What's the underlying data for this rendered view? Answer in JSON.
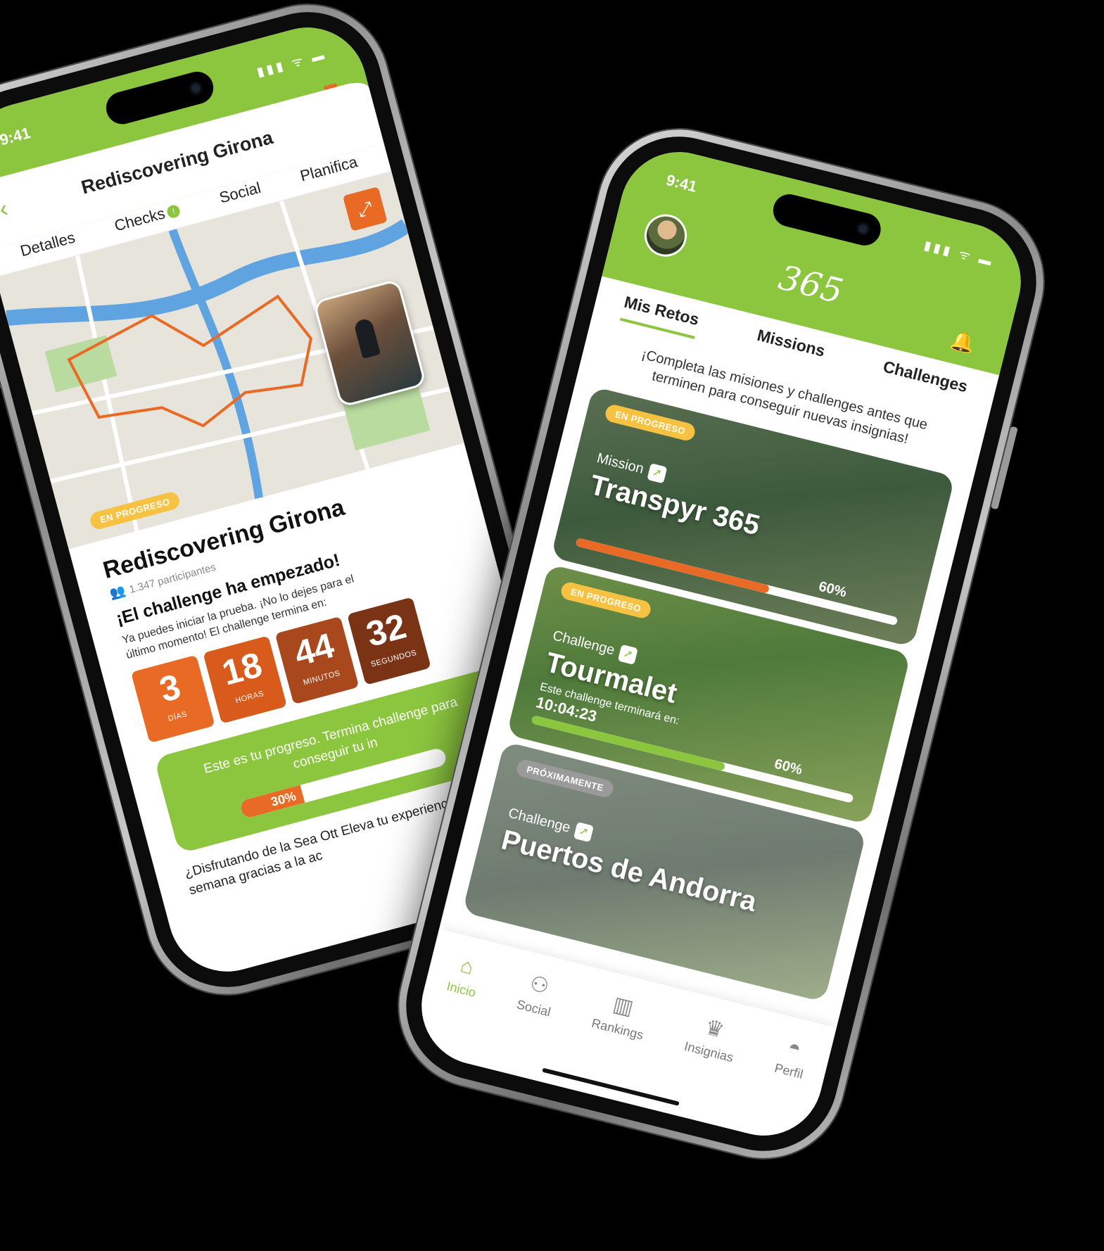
{
  "status": {
    "time": "9:41",
    "icons": "▮▮▮ ᯤ ▬"
  },
  "left": {
    "header_title": "Rediscovering Girona",
    "tabs": [
      {
        "label": "Detalles"
      },
      {
        "label": "Checks",
        "badge": "!"
      },
      {
        "label": "Social"
      },
      {
        "label": "Planifica"
      }
    ],
    "badge_status": "EN PROGRESO",
    "title": "Rediscovering Girona",
    "participants": "1.347 participantes",
    "heading": "¡El challenge ha empezado!",
    "description": "Ya puedes iniciar la prueba. ¡No lo dejes para el último momento! El challenge termina en:",
    "countdown": [
      {
        "value": "3",
        "label": "DÍAS",
        "color": "#e96a24"
      },
      {
        "value": "18",
        "label": "HORAS",
        "color": "#d85b1c"
      },
      {
        "value": "44",
        "label": "MINUTOS",
        "color": "#a9481c"
      },
      {
        "value": "32",
        "label": "SEGUNDOS",
        "color": "#7a3315"
      }
    ],
    "progress_text": "Este es tu progreso. Termina challenge para conseguir tu in",
    "progress_percent": 30,
    "progress_label": "30%",
    "footer_text": "¿Disfrutando de la Sea Ott Eleva tu experiencia cicli semana gracias a la ac"
  },
  "right": {
    "logo": "365",
    "tabs": [
      {
        "label": "Mis Retos",
        "active": true
      },
      {
        "label": "Missions"
      },
      {
        "label": "Challenges"
      }
    ],
    "intro": "¡Completa las misiones y challenges antes que terminen para conseguir nuevas insignias!",
    "cards": [
      {
        "status": "EN PROGRESO",
        "kind": "Mission",
        "name": "Transpyr 365",
        "percent": 60,
        "percent_label": "60%",
        "bar_color": "#e96a24"
      },
      {
        "status": "EN PROGRESO",
        "kind": "Challenge",
        "name": "Tourmalet",
        "meta": "Este challenge terminará en:",
        "meta_time": "10:04:23",
        "percent": 60,
        "percent_label": "60%",
        "bar_color": "#8cc63f"
      },
      {
        "status": "PRÓXIMAMENTE",
        "kind": "Challenge",
        "name": "Puertos de Andorra"
      }
    ],
    "nav": [
      {
        "label": "Inicio",
        "icon": "home-icon",
        "active": true
      },
      {
        "label": "Social",
        "icon": "users-icon"
      },
      {
        "label": "Rankings",
        "icon": "bars-icon"
      },
      {
        "label": "Insignias",
        "icon": "trophy-icon"
      },
      {
        "label": "Perfil",
        "icon": "helmet-icon"
      }
    ]
  },
  "colors": {
    "brand_green": "#8cc63f",
    "accent_orange": "#e96a24",
    "badge_yellow": "#f7c242"
  }
}
